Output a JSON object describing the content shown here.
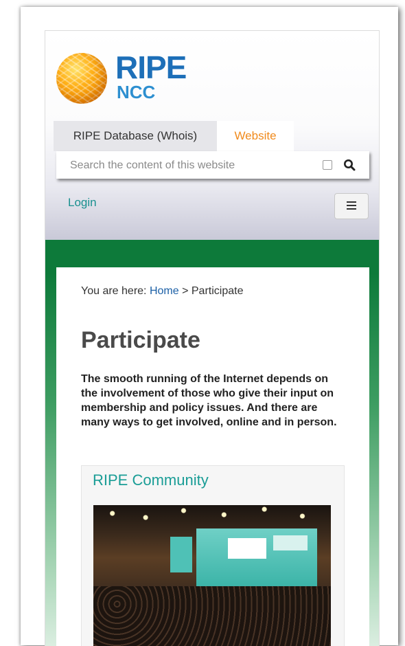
{
  "header": {
    "logo": {
      "primary": "RIPE",
      "secondary": "NCC"
    },
    "tabs": [
      {
        "label": "RIPE Database (Whois)",
        "active": false
      },
      {
        "label": "Website",
        "active": true
      }
    ],
    "search": {
      "placeholder": "Search the content of this website",
      "value": ""
    },
    "login_label": "Login",
    "menu_icon": "hamburger-menu-icon"
  },
  "colors": {
    "brand_blue": "#1d6fb8",
    "active_tab": "#f08a1c",
    "link_teal": "#19908f",
    "green_band": "#0d7a3a"
  },
  "content": {
    "breadcrumb": {
      "prefix": "You are here:",
      "home": "Home",
      "separator": ">",
      "current": "Participate"
    },
    "title": "Participate",
    "intro": "The smooth running of the Internet depends on the involvement of those who give their input on membership and policy issues. And there are many ways to get involved, online and in person.",
    "community": {
      "heading": "RIPE Community",
      "image": "conference-hall-photo"
    }
  }
}
